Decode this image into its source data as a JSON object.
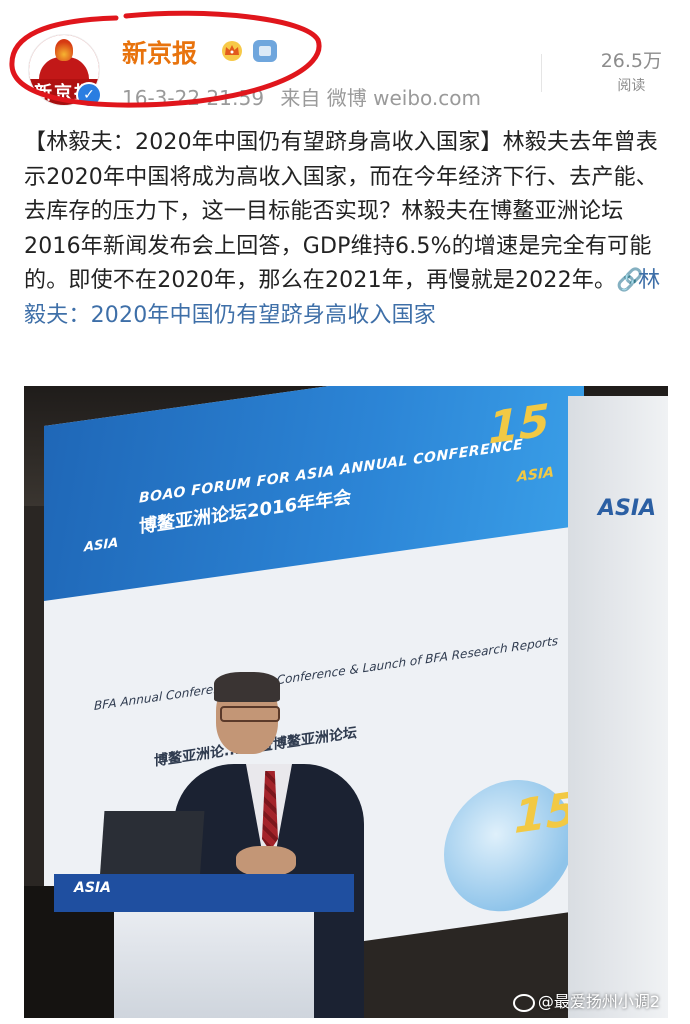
{
  "header": {
    "avatar_text": "新京报",
    "username": "新京报",
    "timestamp": "16-3-22 21:59",
    "source": "来自 微博 weibo.com",
    "read_count": "26.5万",
    "read_label": "阅读"
  },
  "post": {
    "text": "【林毅夫：2020年中国仍有望跻身高收入国家】林毅夫去年曾表示2020年中国将成为高收入国家，而在今年经济下行、去产能、去库存的压力下，这一目标能否实现？林毅夫在博鳌亚洲论坛2016年新闻发布会上回答，GDP维持6.5%的增速是完全有可能的。即使不在2020年，那么在2021年，再慢就是2022年。",
    "link_text": "林毅夫：2020年中国仍有望跻身高收入国家"
  },
  "photo": {
    "banner_en": "BOAO FORUM FOR ASIA ANNUAL CONFERENCE",
    "banner_cn": "博鳌亚洲论坛2016年年会",
    "screen_line1": "BFA Annual Conference 201... Conference & Launch of BFA Research Reports",
    "screen_line2": "博鳌亚洲论... 会暨博鳌亚洲论坛",
    "logo_text": "ASIA",
    "anniversary_mark": "15",
    "podium_label": "ASIA",
    "watermark": "@最爱扬州小调2"
  },
  "colors": {
    "username": "#e8730d",
    "link": "#3e6fa8",
    "verified": "#2a7de1",
    "annotation": "#e0161c"
  }
}
